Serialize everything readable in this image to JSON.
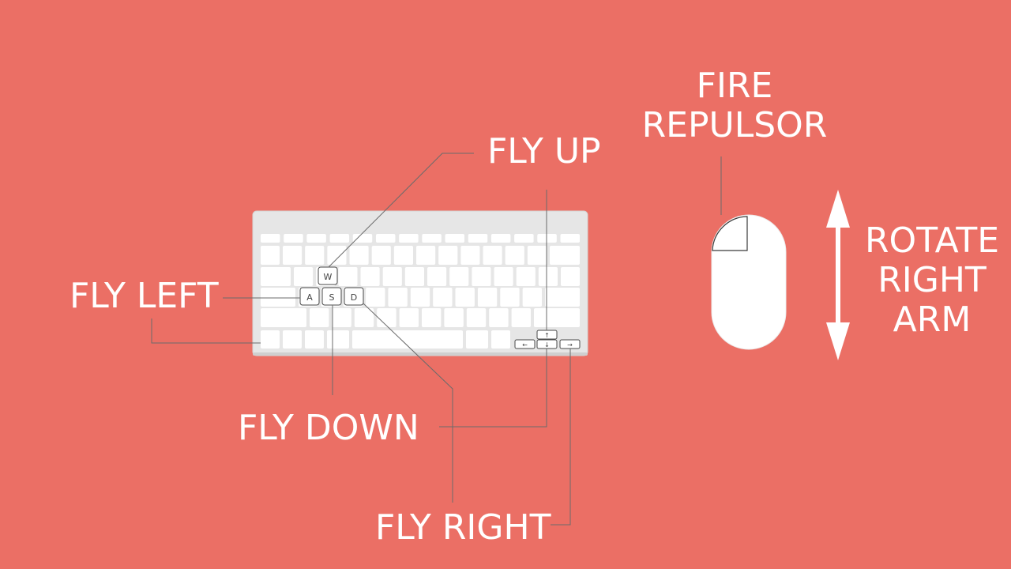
{
  "controls": {
    "fly_up": "FLY UP",
    "fly_left": "FLY LEFT",
    "fly_down": "FLY DOWN",
    "fly_right": "FLY RIGHT",
    "fire_repulsor": [
      "FIRE",
      "REPULSOR"
    ],
    "rotate_right_arm": [
      "ROTATE",
      "RIGHT",
      "ARM"
    ]
  },
  "keys": {
    "w": "W",
    "a": "A",
    "s": "S",
    "d": "D",
    "arrow_up": "↑",
    "arrow_down": "↓",
    "arrow_left": "←",
    "arrow_right": "→"
  },
  "colors": {
    "background": "#eb6f65",
    "keyboard_body": "#e8e8e8",
    "key": "#ffffff",
    "leader_line": "#6b6b6b",
    "label": "#ffffff"
  }
}
